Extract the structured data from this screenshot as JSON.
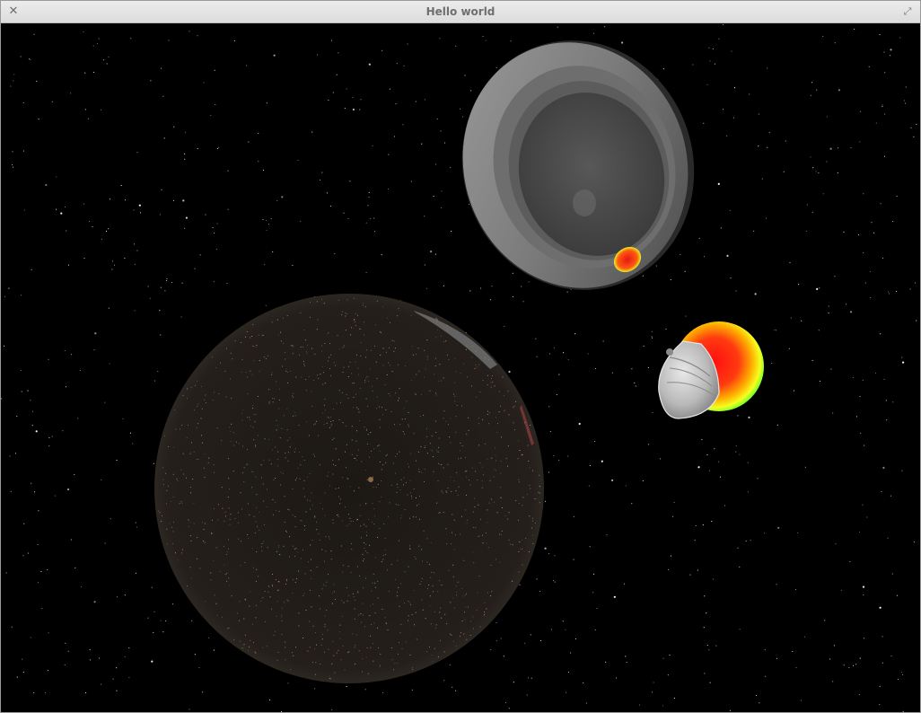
{
  "window": {
    "title": "Hello world",
    "close_icon": "close-icon",
    "maximize_icon": "maximize-icon"
  },
  "scene": {
    "background_color": "#000000",
    "objects": [
      {
        "name": "gray-ring-sphere",
        "color": "#8a8a8a"
      },
      {
        "name": "dark-speckled-sphere",
        "color": "#2a2420"
      },
      {
        "name": "heatmap-sphere",
        "colors": [
          "#ff1a1a",
          "#ffcc00",
          "#33ff33"
        ]
      },
      {
        "name": "glass-hemisphere",
        "color": "#cfcfcf"
      }
    ]
  }
}
